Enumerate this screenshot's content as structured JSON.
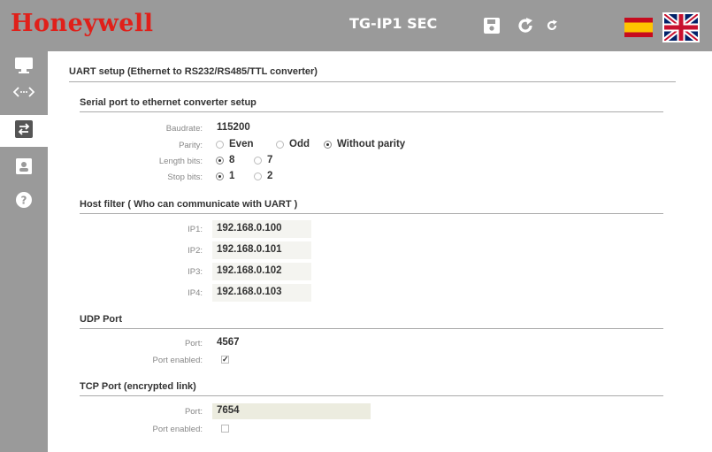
{
  "header": {
    "logo": "Honeywell",
    "device_title": "TG-IP1 SEC",
    "icons": [
      "save-icon",
      "refresh-icon",
      "reload-icon"
    ],
    "languages": [
      "spanish-flag",
      "english-flag"
    ],
    "colors": {
      "bar": "#9a9a9a",
      "logo": "#e0201a"
    }
  },
  "sidebar": {
    "items": [
      {
        "icon": "monitor-icon",
        "active": false
      },
      {
        "icon": "code-icon",
        "active": false
      },
      {
        "icon": "transfer-icon",
        "active": true
      },
      {
        "icon": "user-icon",
        "active": false
      },
      {
        "icon": "help-icon",
        "active": false
      }
    ]
  },
  "page": {
    "title": "UART setup (Ethernet to RS232/RS485/TTL converter)"
  },
  "serial": {
    "title": "Serial port to ethernet converter setup",
    "baudrate_label": "Baudrate:",
    "baudrate_value": "115200",
    "parity_label": "Parity:",
    "parity_options": [
      "Even",
      "Odd",
      "Without parity"
    ],
    "parity_selected": "Without parity",
    "length_label": "Length bits:",
    "length_options": [
      "8",
      "7"
    ],
    "length_selected": "8",
    "stop_label": "Stop bits:",
    "stop_options": [
      "1",
      "2"
    ],
    "stop_selected": "1"
  },
  "host_filter": {
    "title": "Host filter ( Who can communicate with UART )",
    "ips": [
      {
        "label": "IP1:",
        "value": "192.168.0.100"
      },
      {
        "label": "IP2:",
        "value": "192.168.0.101"
      },
      {
        "label": "IP3:",
        "value": "192.168.0.102"
      },
      {
        "label": "IP4:",
        "value": "192.168.0.103"
      }
    ]
  },
  "udp": {
    "title": "UDP Port",
    "port_label": "Port:",
    "port_value": "4567",
    "enabled_label": "Port enabled:",
    "enabled": true
  },
  "tcp": {
    "title": "TCP Port (encrypted link)",
    "port_label": "Port:",
    "port_value": "7654",
    "enabled_label": "Port enabled:",
    "enabled": false
  }
}
